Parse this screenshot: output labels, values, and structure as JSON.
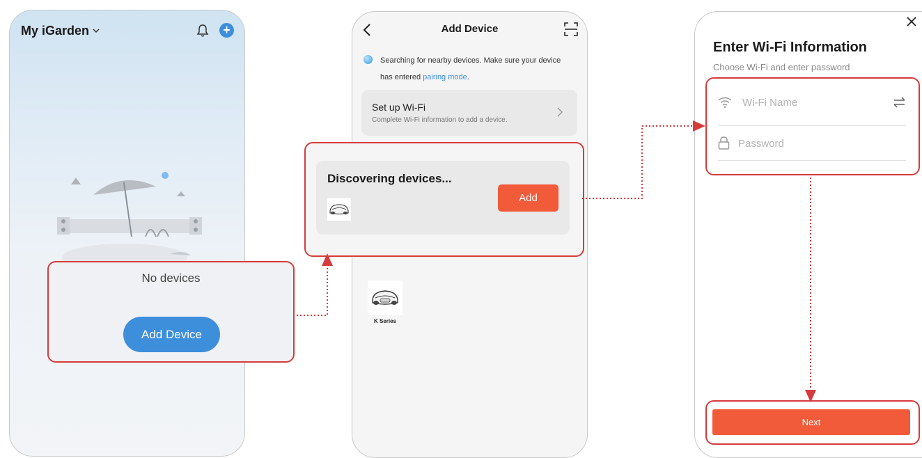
{
  "screen1": {
    "title": "My iGarden",
    "empty_text": "No devices",
    "add_device_label": "Add Device"
  },
  "screen2": {
    "title": "Add Device",
    "searching_text": "Searching for nearby devices. Make sure your device has entered ",
    "pairing_link": "pairing mode",
    "searching_suffix": ".",
    "setup_title": "Set up Wi-Fi",
    "setup_subtitle": "Complete Wi-Fi information to add a device.",
    "discovering_title": "Discovering devices...",
    "add_label": "Add",
    "device_label": "K Series"
  },
  "screen3": {
    "title": "Enter Wi-Fi Information",
    "subtitle": "Choose Wi-Fi and enter password",
    "wifi_placeholder": "Wi-Fi Name",
    "password_placeholder": "Password",
    "next_label": "Next"
  },
  "colors": {
    "accent_orange": "#f15b3a",
    "accent_blue": "#3d8fdb",
    "callout_red": "#d63b3b"
  },
  "icons": [
    "chevron-down-icon",
    "bell-icon",
    "plus-icon",
    "back-arrow-icon",
    "scan-icon",
    "chevron-right-icon",
    "close-icon",
    "wifi-icon",
    "swap-icon",
    "lock-icon",
    "robot-mower-icon"
  ]
}
